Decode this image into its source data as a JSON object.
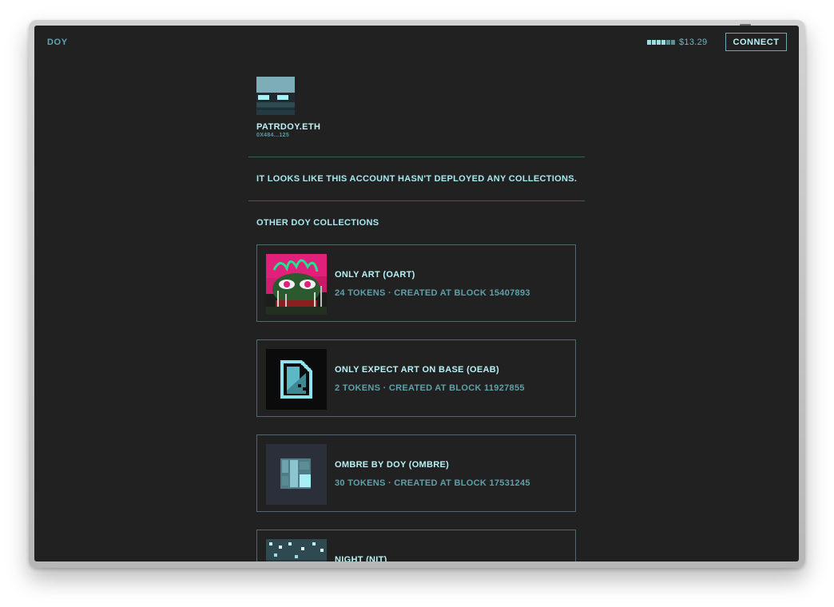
{
  "header": {
    "brand": "DOY",
    "balance": "$13.29",
    "connect_label": "CONNECT"
  },
  "profile": {
    "name": "PATRDOY.ETH",
    "address": "0X484...125"
  },
  "empty_message": "IT LOOKS LIKE THIS ACCOUNT HASN'T DEPLOYED ANY COLLECTIONS.",
  "other_collections": {
    "title": "OTHER DOY COLLECTIONS",
    "items": [
      {
        "title": "ONLY ART (OART)",
        "meta": "24 TOKENS · CREATED AT BLOCK 15407893"
      },
      {
        "title": "ONLY EXPECT ART ON BASE (OEAB)",
        "meta": "2 TOKENS · CREATED AT BLOCK 11927855"
      },
      {
        "title": "OMBRE BY DOY (OMBRE)",
        "meta": "30 TOKENS · CREATED AT BLOCK 17531245"
      },
      {
        "title": "NIGHT (NIT)",
        "meta": ""
      }
    ]
  },
  "colors": {
    "background": "#212121",
    "accent": "#8fd3dc",
    "border": "#4f6a70"
  }
}
